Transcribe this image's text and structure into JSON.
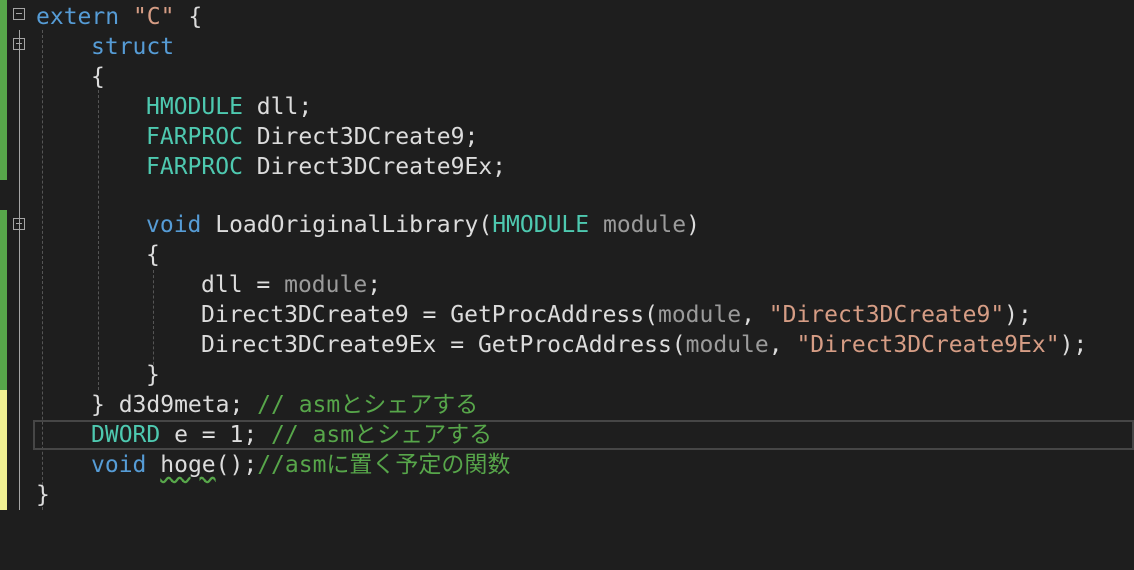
{
  "code": {
    "l0": {
      "kw": "extern",
      "str": "\"C\"",
      "rest": " {"
    },
    "l1": {
      "kw": "struct"
    },
    "l2": {
      "text": "{"
    },
    "l3": {
      "ty": "HMODULE",
      "rest": " dll;"
    },
    "l4": {
      "ty": "FARPROC",
      "rest": " Direct3DCreate9;"
    },
    "l5": {
      "ty": "FARPROC",
      "rest": " Direct3DCreate9Ex;"
    },
    "l7": {
      "kw": "void",
      "a": " LoadOriginalLibrary(",
      "ty": "HMODULE",
      "p": " module",
      "b": ")"
    },
    "l8": {
      "text": "{"
    },
    "l9": {
      "a": "dll = ",
      "p": "module",
      "b": ";"
    },
    "l10": {
      "a": "Direct3DCreate9 = GetProcAddress(",
      "p": "module",
      "c": ", ",
      "str": "\"Direct3DCreate9\"",
      "b": ");"
    },
    "l11": {
      "a": "Direct3DCreate9Ex = GetProcAddress(",
      "p": "module",
      "c": ", ",
      "str": "\"Direct3DCreate9Ex\"",
      "b": ");"
    },
    "l12": {
      "text": "}"
    },
    "l13": {
      "a": "} d3d9meta; ",
      "cm": "// asmとシェアする"
    },
    "l14": {
      "ty": "DWORD",
      "a": " e = 1; ",
      "cm": "// asmとシェアする"
    },
    "l15": {
      "kw": "void",
      "sp": " ",
      "fn": "hoge",
      "a": "();",
      "cm": "//asmに置く予定の関数"
    },
    "l16": {
      "text": "}"
    }
  }
}
